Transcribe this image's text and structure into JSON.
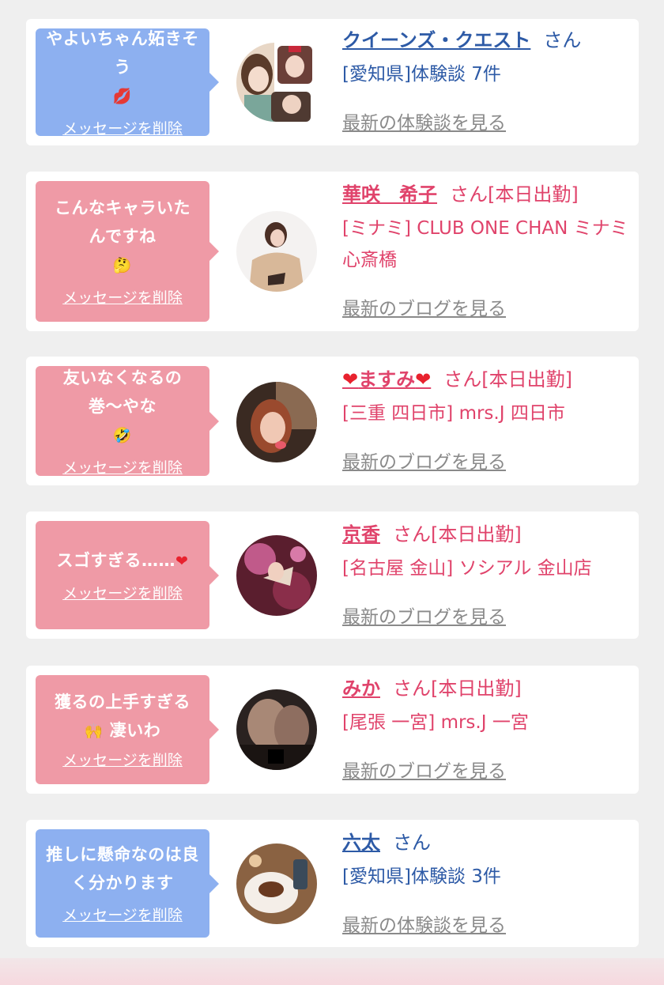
{
  "items": [
    {
      "message": "やよいちゃん妬きそう",
      "message_emoji": "💋",
      "delete_label": "メッセージを削除",
      "name": "クイーンズ・クエスト",
      "name_suffix": "さん",
      "detail": "[愛知県]体験談 7件",
      "more_label": "最新の体験談を見る",
      "theme": "blue"
    },
    {
      "message": "こんなキャラいたんですね",
      "message_emoji": "🤔",
      "delete_label": "メッセージを削除",
      "name": "華咲　希子",
      "name_suffix": "さん[本日出勤]",
      "detail": "[ミナミ] CLUB ONE CHAN ミナミ 心斎橋",
      "more_label": "最新のブログを見る",
      "theme": "pink"
    },
    {
      "message": "友いなくなるの巻〜やな",
      "message_emoji": "🤣",
      "delete_label": "メッセージを削除",
      "name": "ますみ",
      "name_prefix_icon": "❤",
      "name_suffix_icon": "❤",
      "name_suffix": "さん[本日出勤]",
      "detail": "[三重 四日市] mrs.J 四日市",
      "more_label": "最新のブログを見る",
      "theme": "pink"
    },
    {
      "message": "スゴすぎる……",
      "message_emoji": "❤",
      "delete_label": "メッセージを削除",
      "name": "京香",
      "name_suffix": "さん[本日出勤]",
      "detail": "[名古屋 金山] ソシアル 金山店",
      "more_label": "最新のブログを見る",
      "theme": "pink"
    },
    {
      "message_line1": "獲るの上手すぎる",
      "message_line2_emoji": "🙌",
      "message_line2": "凄いわ",
      "delete_label": "メッセージを削除",
      "name": "みか",
      "name_suffix": "さん[本日出勤]",
      "detail": "[尾張 一宮] mrs.J 一宮",
      "more_label": "最新のブログを見る",
      "theme": "pink"
    },
    {
      "message": "推しに懸命なのは良く分かります",
      "delete_label": "メッセージを削除",
      "name": "六太",
      "name_suffix": "さん",
      "detail": "[愛知県]体験談 3件",
      "more_label": "最新の体験談を見る",
      "theme": "blue"
    }
  ],
  "colors": {
    "blue_bubble": "#8db0f0",
    "pink_bubble": "#ef9aa6",
    "blue_text": "#2d5aa6",
    "pink_text": "#e0436b",
    "link_gray": "#8a8a8a"
  }
}
